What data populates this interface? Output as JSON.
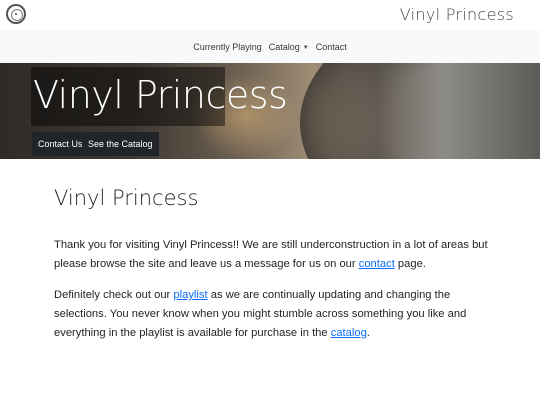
{
  "topbar": {
    "logo_icon": "vinyl-record-icon",
    "brand": "Vinyl Princess"
  },
  "navbar": {
    "items": [
      {
        "label": "Currently Playing"
      },
      {
        "label": "Catalog",
        "has_dropdown": true,
        "dropdown_icon": "caret-down-icon"
      },
      {
        "label": "Contact"
      }
    ]
  },
  "hero": {
    "title": "Vinyl Princess",
    "buttons": [
      {
        "label": "Contact Us"
      },
      {
        "label": "See the Catalog"
      }
    ]
  },
  "main": {
    "title": "Vinyl Princess",
    "p1": {
      "before": "Thank you for visiting Vinyl Princess!! We are still underconstruction in a lot of areas but please browse the site and leave us a message for us on our ",
      "link": "contact",
      "after": " page."
    },
    "p2": {
      "before": "Definitely check out our ",
      "link1": "playlist",
      "middle": " as we are continually updating and changing the selections. You never know when you might stumble across something you like and everything in the playlist is available for purchase in the ",
      "link2": "catalog",
      "after": "."
    }
  },
  "colors": {
    "link": "#0d6efd",
    "button_bg": "#212529",
    "navbar_bg": "#f8f9fa"
  }
}
